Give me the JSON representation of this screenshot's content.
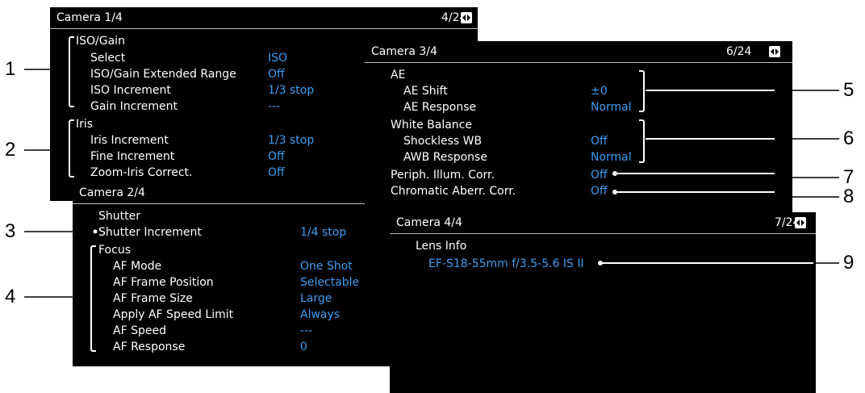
{
  "icons": {
    "nav": "left-right-arrows-icon"
  },
  "colors": {
    "value": "#3d9df2",
    "panel_bg": "#000000",
    "label": "#ffffff"
  },
  "camera1": {
    "title": "Camera 1/4",
    "page": "4/24",
    "iso_group": "ISO/Gain",
    "rows_iso": [
      {
        "label": "Select",
        "value": "ISO"
      },
      {
        "label": "ISO/Gain Extended Range",
        "value": "Off"
      },
      {
        "label": "ISO Increment",
        "value": "1/3 stop"
      },
      {
        "label": "Gain Increment",
        "value": "---"
      }
    ],
    "iris_group": "Iris",
    "rows_iris": [
      {
        "label": "Iris Increment",
        "value": "1/3 stop"
      },
      {
        "label": "Fine Increment",
        "value": "Off"
      },
      {
        "label": "Zoom-Iris Correct.",
        "value": "Off"
      }
    ]
  },
  "camera2": {
    "title": "Camera 2/4",
    "shutter_group": "Shutter",
    "shutter_row": {
      "label": "Shutter Increment",
      "value": "1/4 stop"
    },
    "focus_group": "Focus",
    "rows_focus": [
      {
        "label": "AF Mode",
        "value": "One Shot"
      },
      {
        "label": "AF Frame Position",
        "value": "Selectable"
      },
      {
        "label": "AF Frame Size",
        "value": "Large"
      },
      {
        "label": "Apply AF Speed Limit",
        "value": "Always"
      },
      {
        "label": "AF Speed",
        "value": "---"
      },
      {
        "label": "AF Response",
        "value": "0"
      }
    ]
  },
  "camera3": {
    "title": "Camera 3/4",
    "page": "6/24",
    "ae_group": "AE",
    "rows_ae": [
      {
        "label": "AE Shift",
        "value": "±0"
      },
      {
        "label": "AE Response",
        "value": "Normal"
      }
    ],
    "wb_group": "White Balance",
    "rows_wb": [
      {
        "label": "Shockless WB",
        "value": "Off"
      },
      {
        "label": "AWB Response",
        "value": "Normal"
      }
    ],
    "periph": {
      "label": "Periph. Illum. Corr.",
      "value": "Off"
    },
    "chroma": {
      "label": "Chromatic Aberr. Corr.",
      "value": "Off"
    }
  },
  "camera4": {
    "title": "Camera 4/4",
    "page": "7/24",
    "lens_group": "Lens Info",
    "lens_value": "EF-S18-55mm f/3.5-5.6 IS II"
  },
  "callouts": [
    "1",
    "2",
    "3",
    "4",
    "5",
    "6",
    "7",
    "8",
    "9"
  ]
}
